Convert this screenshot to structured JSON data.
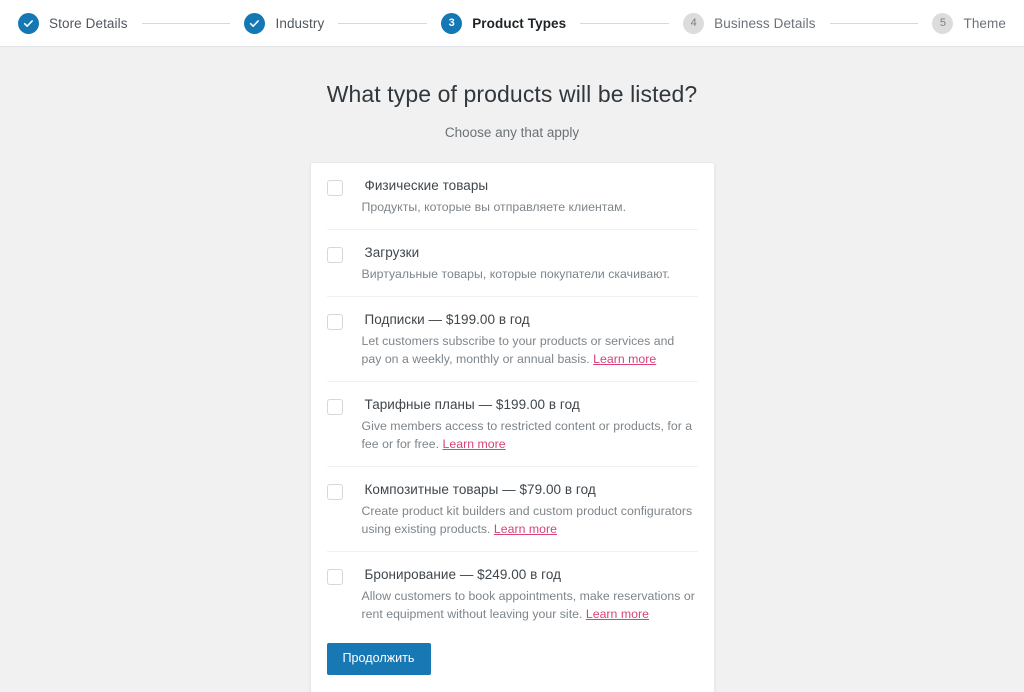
{
  "stepper": {
    "steps": [
      {
        "marker": "check-icon",
        "number": "1",
        "label": "Store Details",
        "state": "done"
      },
      {
        "marker": "check-icon",
        "number": "2",
        "label": "Industry",
        "state": "done"
      },
      {
        "marker": "3",
        "number": "3",
        "label": "Product Types",
        "state": "current"
      },
      {
        "marker": "4",
        "number": "4",
        "label": "Business Details",
        "state": "upcoming"
      },
      {
        "marker": "5",
        "number": "5",
        "label": "Theme",
        "state": "upcoming"
      }
    ]
  },
  "main": {
    "headline": "What type of products will be listed?",
    "subhead": "Choose any that apply",
    "items": [
      {
        "title": "Физические товары",
        "desc": "Продукты, которые вы отправляете клиентам.",
        "link": "",
        "checked": false
      },
      {
        "title": "Загрузки",
        "desc": "Виртуальные товары, которые покупатели скачивают.",
        "link": "",
        "checked": false
      },
      {
        "title": "Подписки — $199.00 в год",
        "desc": "Let customers subscribe to your products or services and pay on a weekly, monthly or annual basis. ",
        "link": "Learn more",
        "checked": false
      },
      {
        "title": "Тарифные планы — $199.00 в год",
        "desc": "Give members access to restricted content or products, for a fee or for free. ",
        "link": "Learn more",
        "checked": false
      },
      {
        "title": "Композитные товары — $79.00 в год",
        "desc": "Create product kit builders and custom product configurators using existing products. ",
        "link": "Learn more",
        "checked": false
      },
      {
        "title": "Бронирование — $249.00 в год",
        "desc": "Allow customers to book appointments, make reservations or rent equipment without leaving your site. ",
        "link": "Learn more",
        "checked": false
      }
    ],
    "continue_label": "Продолжить"
  },
  "colors": {
    "accent": "#1878b4",
    "link": "#d8427a",
    "page_bg": "#f1f1f1",
    "card_bg": "#ffffff",
    "upcoming_step": "#dcdcdc"
  }
}
